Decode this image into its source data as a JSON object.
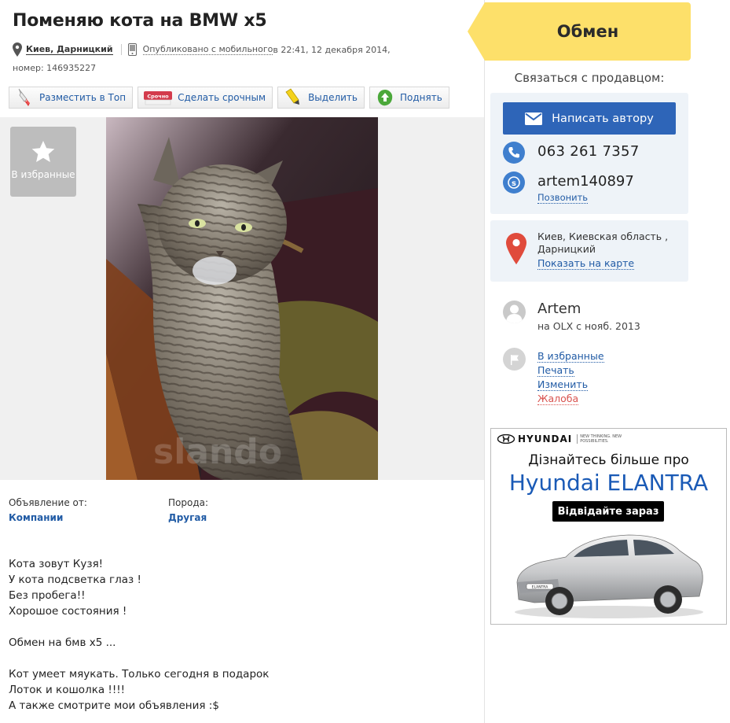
{
  "listing": {
    "title": "Поменяю кота на BMW x5",
    "city": "Киев, Дарницкий",
    "published_mobile": "Опубликовано с мобильного",
    "published_date": " в 22:41, 12 декабря 2014,",
    "number": "номер: 146935227"
  },
  "toolbar": {
    "top_label": "Разместить в Топ",
    "urgent_label": "Сделать срочным",
    "urgent_badge": "Срочно",
    "highlight_label": "Выделить",
    "raise_label": "Поднять"
  },
  "gallery": {
    "favorites_label": "В избранные",
    "watermark": "slando"
  },
  "params": {
    "from_label": "Объявление от:",
    "from_value": "Компании",
    "breed_label": "Порода:",
    "breed_value": "Другая"
  },
  "description": [
    "Кота зовут Кузя!",
    "У кота подсветка глаз !",
    "Без пробега!!",
    "Хорошое состояния !",
    "",
    "Обмен на бмв x5 ...",
    "",
    "Кот умеет мяукать. Только сегодня в подарок",
    "Лоток и кошолка !!!!",
    "А также смотрите мои объявления :$"
  ],
  "sidebar": {
    "exchange_label": "Обмен",
    "contact_title": "Связаться с продавцом:",
    "write_button": "Написать автору",
    "phone": "063 261 7357",
    "skype": "artem140897",
    "call_link": "Позвонить",
    "location_line1": "Киев, Киевская область ,",
    "location_line2": "Дарницкий",
    "map_link": "Показать на карте",
    "user_name": "Artem",
    "user_since": "на OLX с нояб. 2013",
    "actions": {
      "favorites": "В избранные",
      "print": "Печать",
      "edit": "Изменить",
      "complain": "Жалоба"
    }
  },
  "ad": {
    "brand": "HYUNDAI",
    "tagline": "NEW THINKING. NEW POSSIBILITIES.",
    "line1": "Дізнайтесь більше про",
    "line2": "Hyundai ELANTRA",
    "cta": "Відвідайте зараз",
    "plate": "ELANTRA"
  },
  "colors": {
    "link": "#215ba5",
    "exchange_bg": "#fde06a",
    "primary_button": "#2e65b8",
    "contact_box_bg": "#eef3f8",
    "complain": "#d9534f"
  }
}
